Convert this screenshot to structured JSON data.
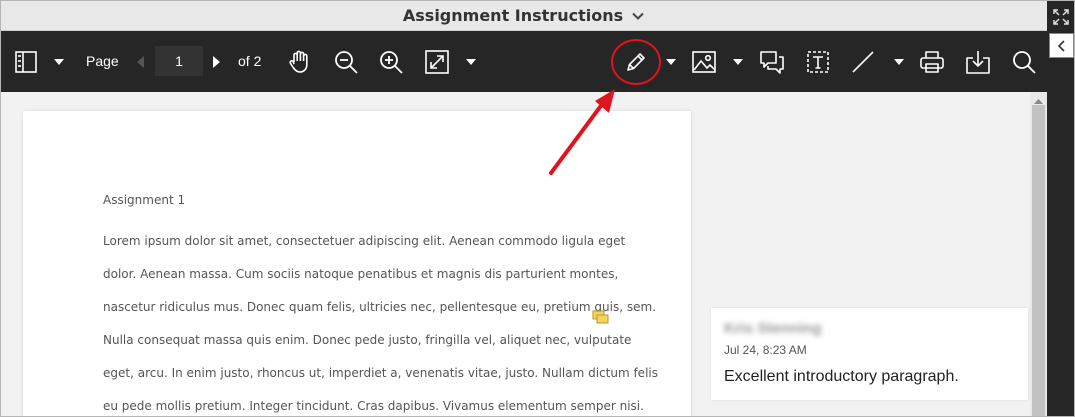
{
  "title_bar": {
    "title": "Assignment Instructions"
  },
  "toolbar": {
    "page_label": "Page",
    "page_value": "1",
    "of_label": "of 2"
  },
  "document": {
    "heading": "Assignment 1",
    "lines": [
      "Lorem ipsum dolor sit amet, consectetuer adipiscing elit. Aenean commodo ligula eget",
      "dolor. Aenean massa. Cum sociis natoque penatibus et magnis dis parturient montes,",
      "nascetur ridiculus mus. Donec quam felis, ultricies nec, pellentesque eu, pretium quis, sem.",
      "Nulla consequat massa quis enim. Donec pede justo, fringilla vel, aliquet nec, vulputate",
      "eget, arcu. In enim justo, rhoncus ut, imperdiet a, venenatis vitae, justo. Nullam dictum felis",
      "eu pede mollis pretium. Integer tincidunt. Cras dapibus. Vivamus elementum semper nisi."
    ]
  },
  "comment": {
    "author": "Kris Stenning",
    "time": "Jul 24, 8:23 AM",
    "text": "Excellent introductory paragraph."
  },
  "icons": {
    "sidebar": "sidebar-toggle-icon",
    "pan": "hand-icon",
    "zoom_out": "zoom-out-icon",
    "zoom_in": "zoom-in-icon",
    "fit": "fit-page-icon",
    "draw": "pencil-icon",
    "image": "image-icon",
    "comment": "comment-icon",
    "text": "text-box-icon",
    "line": "line-icon",
    "print": "printer-icon",
    "download": "download-icon",
    "search": "search-icon"
  },
  "colors": {
    "toolbar_bg": "#262626",
    "annotation_red": "#e0141e",
    "note_marker": "#f4d35e"
  }
}
